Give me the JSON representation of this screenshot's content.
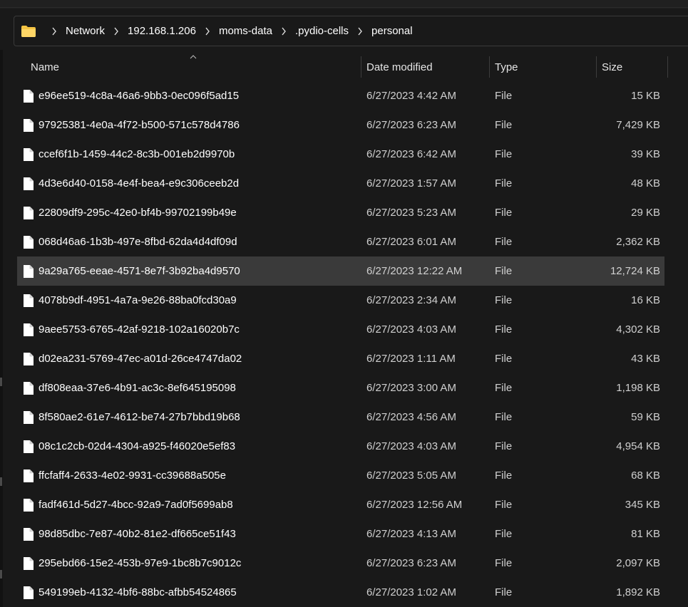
{
  "breadcrumb": [
    "Network",
    "192.168.1.206",
    "moms-data",
    ".pydio-cells",
    "personal"
  ],
  "columns": {
    "name": "Name",
    "date": "Date modified",
    "type": "Type",
    "size": "Size"
  },
  "colors": {
    "background": "#191919",
    "selected_row": "#3a3a3a",
    "folder": "#f5c443"
  },
  "icons": {
    "folder": "folder-icon",
    "file": "file-icon",
    "chevron": "chevron-right-icon",
    "sort": "sort-ascending-icon"
  },
  "selected_index": 6,
  "files": [
    {
      "name": "e96ee519-4c8a-46a6-9bb3-0ec096f5ad15",
      "date": "6/27/2023 4:42 AM",
      "type": "File",
      "size": "15 KB"
    },
    {
      "name": "97925381-4e0a-4f72-b500-571c578d4786",
      "date": "6/27/2023 6:23 AM",
      "type": "File",
      "size": "7,429 KB"
    },
    {
      "name": "ccef6f1b-1459-44c2-8c3b-001eb2d9970b",
      "date": "6/27/2023 6:42 AM",
      "type": "File",
      "size": "39 KB"
    },
    {
      "name": "4d3e6d40-0158-4e4f-bea4-e9c306ceeb2d",
      "date": "6/27/2023 1:57 AM",
      "type": "File",
      "size": "48 KB"
    },
    {
      "name": "22809df9-295c-42e0-bf4b-99702199b49e",
      "date": "6/27/2023 5:23 AM",
      "type": "File",
      "size": "29 KB"
    },
    {
      "name": "068d46a6-1b3b-497e-8fbd-62da4d4df09d",
      "date": "6/27/2023 6:01 AM",
      "type": "File",
      "size": "2,362 KB"
    },
    {
      "name": "9a29a765-eeae-4571-8e7f-3b92ba4d9570",
      "date": "6/27/2023 12:22 AM",
      "type": "File",
      "size": "12,724 KB"
    },
    {
      "name": "4078b9df-4951-4a7a-9e26-88ba0fcd30a9",
      "date": "6/27/2023 2:34 AM",
      "type": "File",
      "size": "16 KB"
    },
    {
      "name": "9aee5753-6765-42af-9218-102a16020b7c",
      "date": "6/27/2023 4:03 AM",
      "type": "File",
      "size": "4,302 KB"
    },
    {
      "name": "d02ea231-5769-47ec-a01d-26ce4747da02",
      "date": "6/27/2023 1:11 AM",
      "type": "File",
      "size": "43 KB"
    },
    {
      "name": "df808eaa-37e6-4b91-ac3c-8ef645195098",
      "date": "6/27/2023 3:00 AM",
      "type": "File",
      "size": "1,198 KB"
    },
    {
      "name": "8f580ae2-61e7-4612-be74-27b7bbd19b68",
      "date": "6/27/2023 4:56 AM",
      "type": "File",
      "size": "59 KB"
    },
    {
      "name": "08c1c2cb-02d4-4304-a925-f46020e5ef83",
      "date": "6/27/2023 4:03 AM",
      "type": "File",
      "size": "4,954 KB"
    },
    {
      "name": "ffcfaff4-2633-4e02-9931-cc39688a505e",
      "date": "6/27/2023 5:05 AM",
      "type": "File",
      "size": "68 KB"
    },
    {
      "name": "fadf461d-5d27-4bcc-92a9-7ad0f5699ab8",
      "date": "6/27/2023 12:56 AM",
      "type": "File",
      "size": "345 KB"
    },
    {
      "name": "98d85dbc-7e87-40b2-81e2-df665ce51f43",
      "date": "6/27/2023 4:13 AM",
      "type": "File",
      "size": "81 KB"
    },
    {
      "name": "295ebd66-15e2-453b-97e9-1bc8b7c9012c",
      "date": "6/27/2023 6:23 AM",
      "type": "File",
      "size": "2,097 KB"
    },
    {
      "name": "549199eb-4132-4bf6-88bc-afbb54524865",
      "date": "6/27/2023 1:02 AM",
      "type": "File",
      "size": "1,892 KB"
    }
  ]
}
